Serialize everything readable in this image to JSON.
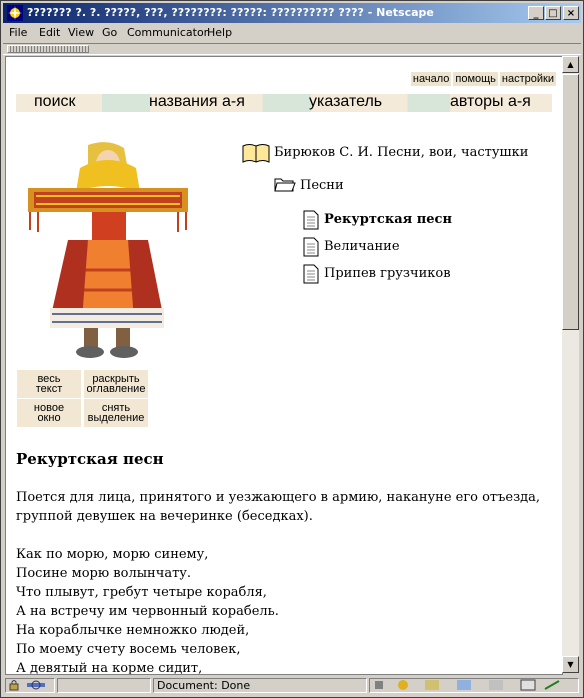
{
  "window": {
    "title": "??????? ?. ?. ?????, ???, ????????: ?????: ?????????? ???? - Netscape"
  },
  "menu": [
    "File",
    "Edit",
    "View",
    "Go",
    "Communicator",
    "Help"
  ],
  "toplinks": [
    "начало",
    "помощь",
    "настройки"
  ],
  "nav": [
    "поиск",
    "названия а-я",
    "указатель",
    "авторы а-я"
  ],
  "side_buttons": [
    {
      "line1": "весь",
      "line2": "текст"
    },
    {
      "line1": "раскрыть",
      "line2": "оглавление"
    },
    {
      "line1": "новое",
      "line2": "окно"
    },
    {
      "line1": "снять",
      "line2": "выделение"
    }
  ],
  "tree": {
    "book": "Бирюков С. И. Песни, вои, частушки",
    "folder": "Песни",
    "items": [
      "Рекуртская песн",
      "Величание",
      "Припев грузчиков"
    ]
  },
  "article": {
    "title": "Рекуртская песн",
    "intro": "Поется для лица, принятого и уезжающего в армию, накануне его отъезда, группой девушек на вечеринке (беседках).",
    "lines": [
      "Как по морю, морю синему,",
      "Посине морю волынчату.",
      "Что плывут, гребут четыре корабля,",
      "А на встречу им червонный корабель.",
      "На кораблычке немножко людей,",
      "По моему счету восемь человек,",
      "А девятый на корме сидит,"
    ]
  },
  "status": {
    "text": "Document: Done"
  },
  "colors": {
    "titlebar_start": "#0a246a",
    "titlebar_end": "#a6caf0",
    "nav_beige": "#f4ead9",
    "nav_green": "#d8e6da"
  }
}
